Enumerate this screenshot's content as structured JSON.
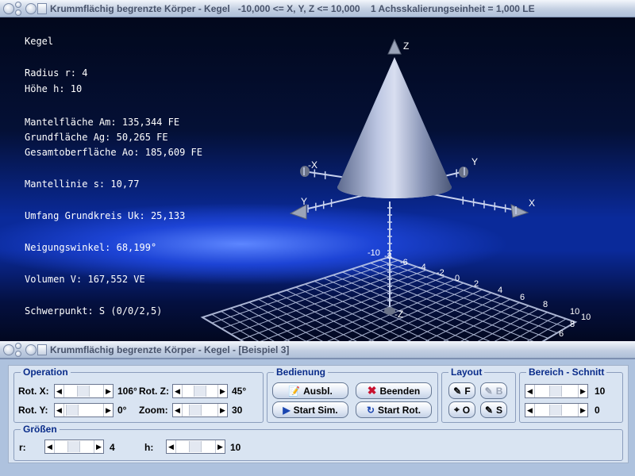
{
  "window_main": {
    "title": "Krummflächig begrenzte Körper - Kegel   -10,000 <= X, Y, Z <= 10,000    1 Achsskalierungseinheit = 1,000 LE"
  },
  "info": {
    "title": "Kegel",
    "radius": "Radius r: 4",
    "hoehe": "Höhe h: 10",
    "mantelflaeche": "Mantelfläche Am: 135,344 FE",
    "grundflaeche": "Grundfläche Ag: 50,265 FE",
    "gesamtoberflaeche": "Gesamtoberfläche Ao: 185,609 FE",
    "mantellinie": "Mantellinie s: 10,77",
    "umfang": "Umfang Grundkreis Uk: 25,133",
    "neigungswinkel": "Neigungswinkel: 68,199°",
    "volumen": "Volumen V: 167,552 VE",
    "schwerpunkt": "Schwerpunkt: S (0/0/2,5)"
  },
  "axes": {
    "x": "X",
    "neg_x": "-X",
    "y": "Y",
    "neg_y": "Y",
    "z": "Z",
    "neg_z": "-Z"
  },
  "grid_labels": [
    "-10",
    "-8",
    "-6",
    "-4",
    "-2",
    "0",
    "2",
    "4",
    "6",
    "8",
    "10",
    "10",
    "8",
    "6"
  ],
  "window_control": {
    "title": "Krummflächig begrenzte Körper - Kegel - [Beispiel 3]"
  },
  "operation": {
    "title": "Operation",
    "rot_x_label": "Rot. X:",
    "rot_x_value": "106°",
    "rot_y_label": "Rot. Y:",
    "rot_y_value": "0°",
    "rot_z_label": "Rot. Z:",
    "rot_z_value": "45°",
    "zoom_label": "Zoom:",
    "zoom_value": "30"
  },
  "bedienung": {
    "title": "Bedienung",
    "ausbl": "Ausbl.",
    "beenden": "Beenden",
    "start_sim": "Start Sim.",
    "start_rot": "Start Rot."
  },
  "layout": {
    "title": "Layout",
    "f": "F",
    "b": "B",
    "o": "O",
    "s": "S"
  },
  "bereich": {
    "title": "Bereich - Schnitt",
    "value1": "10",
    "value2": "0"
  },
  "groessen": {
    "title": "Größen",
    "r_label": "r:",
    "r_value": "4",
    "h_label": "h:",
    "h_value": "10"
  },
  "colors": {
    "accent": "#0a2c8a",
    "view_bg": "#0a2a9a",
    "grid": "#c8d2ee"
  }
}
